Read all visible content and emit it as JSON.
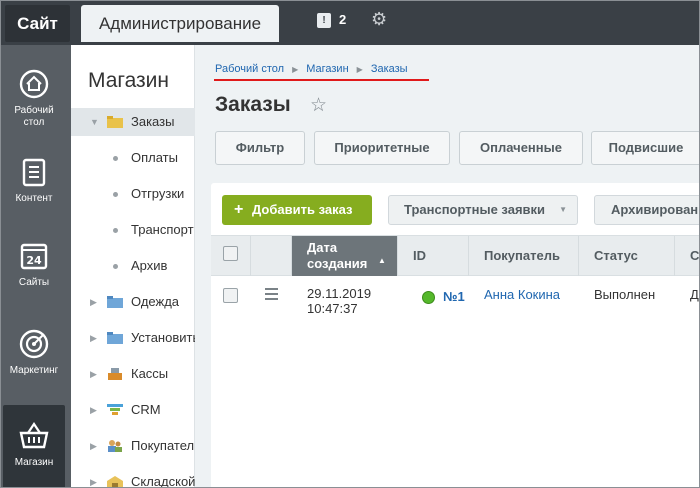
{
  "topbar": {
    "site_tab": "Сайт",
    "admin_tab": "Администрирование",
    "notifications_count": "2",
    "notifications_icon": "notifications-icon",
    "settings_icon": "gear-icon"
  },
  "iconbar": {
    "items": [
      {
        "label_line1": "Рабочий",
        "label_line2": "стол",
        "icon": "home-icon"
      },
      {
        "label_line1": "Контент",
        "label_line2": "",
        "icon": "document-icon"
      },
      {
        "label_line1": "Сайты",
        "label_line2": "",
        "icon": "calendar-icon"
      },
      {
        "label_line1": "Маркетинг",
        "label_line2": "",
        "icon": "target-icon"
      },
      {
        "label_line1": "Магазин",
        "label_line2": "",
        "icon": "basket-icon"
      }
    ]
  },
  "tree": {
    "title": "Магазин",
    "items": [
      {
        "label": "Заказы"
      },
      {
        "label": "Оплаты"
      },
      {
        "label": "Отгрузки"
      },
      {
        "label": "Транспорт"
      },
      {
        "label": "Архив"
      },
      {
        "label": "Одежда"
      },
      {
        "label": "Установить"
      },
      {
        "label": "Кассы"
      },
      {
        "label": "CRM"
      },
      {
        "label": "Покупатели"
      },
      {
        "label": "Складской"
      }
    ]
  },
  "breadcrumb": {
    "items": [
      "Рабочий стол",
      "Магазин",
      "Заказы"
    ]
  },
  "page": {
    "title": "Заказы",
    "favorite_icon": "star-icon"
  },
  "filters": {
    "buttons": [
      "Фильтр",
      "Приоритетные",
      "Оплаченные",
      "Подвисшие"
    ]
  },
  "toolbar": {
    "add_label": "Добавить заказ",
    "transport_label": "Транспортные заявки",
    "archive_label": "Архивированные"
  },
  "table": {
    "headers": {
      "date_line1": "Дата",
      "date_line2": "создания",
      "id": "ID",
      "buyer": "Покупатель",
      "status": "Статус",
      "next": "С"
    },
    "rows": [
      {
        "date": "29.11.2019",
        "time": "10:47:37",
        "id": "№1",
        "buyer": "Анна Кокина",
        "status": "Выполнен",
        "next": "Д"
      }
    ]
  },
  "colors": {
    "accent_green": "#86ad1f",
    "link_blue": "#2067b0",
    "status_green": "#55b82b",
    "underline_red": "#e01a1a"
  }
}
